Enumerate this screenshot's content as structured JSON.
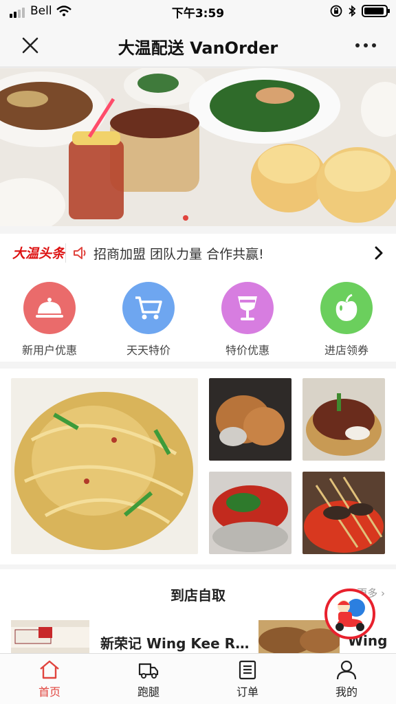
{
  "status": {
    "carrier": "Bell",
    "time": "下午3:59"
  },
  "nav": {
    "title": "大温配送 VanOrder"
  },
  "notice": {
    "brand": "大温头条",
    "text": "招商加盟 团队力量 合作共赢!"
  },
  "shortcuts": [
    {
      "label": "新用户优惠",
      "color": "#ea6b6b",
      "icon": "cloche-icon"
    },
    {
      "label": "天天特价",
      "color": "#6ea6f0",
      "icon": "cart-icon"
    },
    {
      "label": "特价优惠",
      "color": "#d77de0",
      "icon": "glass-icon"
    },
    {
      "label": "进店领券",
      "color": "#6bcf5d",
      "icon": "apple-icon"
    }
  ],
  "pickup": {
    "title": "到店自取",
    "more": "更多",
    "stores": [
      {
        "name": "新荣记 Wing Kee R..."
      },
      {
        "name": "Wing"
      }
    ]
  },
  "tabs": [
    {
      "label": "首页",
      "icon": "home-icon",
      "active": true
    },
    {
      "label": "跑腿",
      "icon": "truck-icon",
      "active": false
    },
    {
      "label": "订单",
      "icon": "list-icon",
      "active": false
    },
    {
      "label": "我的",
      "icon": "user-icon",
      "active": false
    }
  ],
  "colors": {
    "accent": "#e0443e",
    "badge_border": "#e8212d"
  }
}
